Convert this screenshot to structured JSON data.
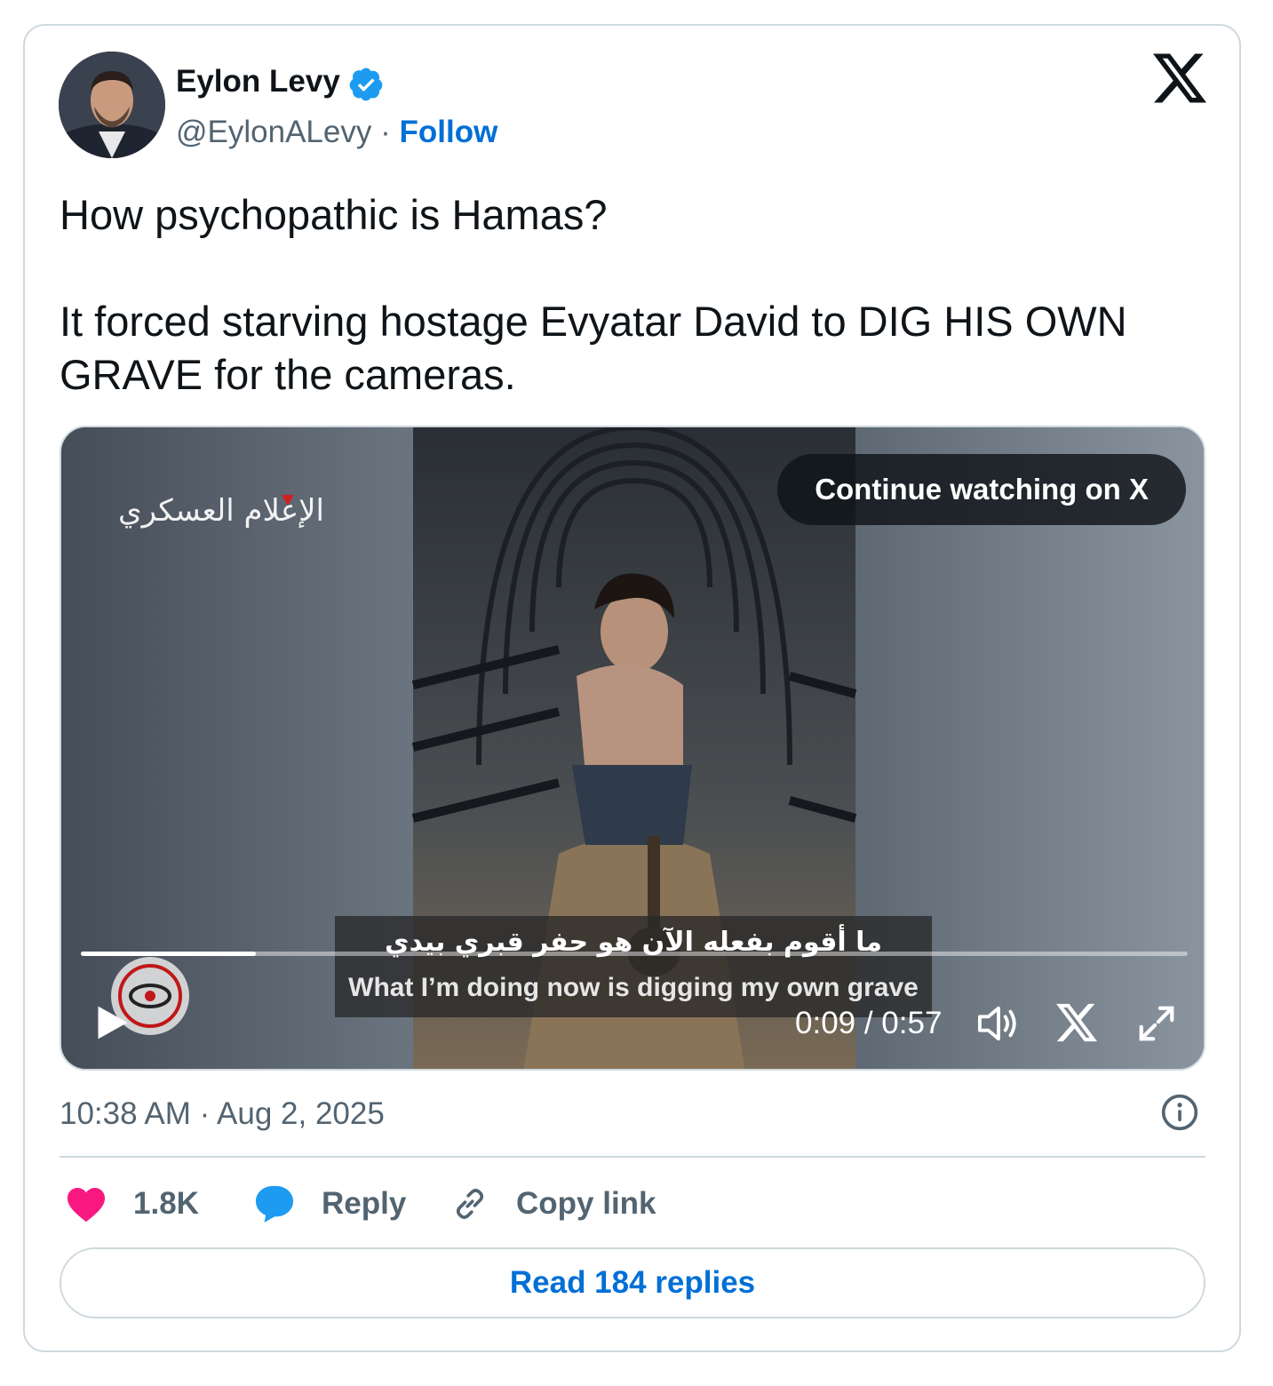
{
  "author": {
    "name": "Eylon Levy",
    "handle": "@EylonALevy",
    "separator": "·",
    "follow_label": "Follow"
  },
  "tweet": {
    "paragraphs": [
      "How psychopathic is Hamas?",
      "It forced starving hostage Evyatar David to DIG HIS OWN GRAVE for the cameras."
    ]
  },
  "media": {
    "continue_label": "Continue watching on X",
    "subtitle_arabic": "ما أقوم بفعله الآن هو حفر قبري بيدي",
    "subtitle_english": "What I’m doing now is digging my own grave",
    "time_display": "0:09 / 0:57",
    "progress_fraction": 0.158
  },
  "meta": {
    "timestamp": "10:38 AM · Aug 2, 2025"
  },
  "actions": {
    "like_count": "1.8K",
    "reply_label": "Reply",
    "copy_label": "Copy link"
  },
  "read_replies_label": "Read 184 replies",
  "colors": {
    "accent_blue": "#006fd6",
    "like_pink": "#f91880",
    "reply_blue": "#1d9bf0",
    "verified_blue": "#1d9bf0",
    "muted_text": "#536471",
    "border": "#cfd9de"
  },
  "icons": {
    "verified": "verified-badge-icon",
    "x_logo": "x-logo-icon",
    "play": "play-icon",
    "volume": "volume-icon",
    "fullscreen": "fullscreen-icon",
    "info": "info-icon",
    "like": "heart-icon",
    "reply": "speech-bubble-icon",
    "copy": "link-icon"
  }
}
